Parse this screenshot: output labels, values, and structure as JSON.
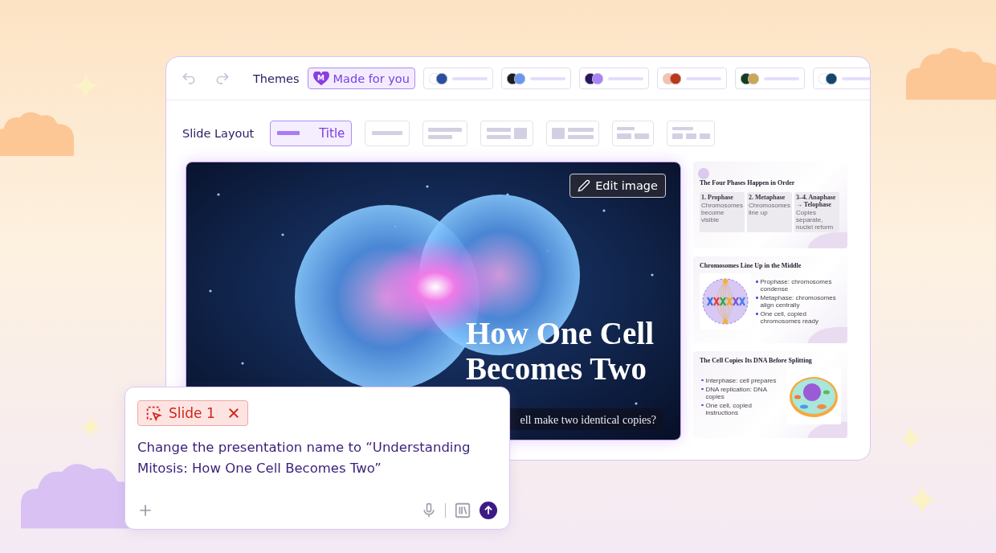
{
  "toolbar": {
    "themes_label": "Themes",
    "made_for_you": {
      "letter": "M",
      "label": "Made for you",
      "selected": true
    },
    "themes": [
      {
        "selected": false,
        "dots": [
          {
            "color": "#ffffff"
          },
          {
            "color": "#2a4f9c"
          }
        ]
      },
      {
        "selected": false,
        "dots": [
          {
            "color": "#1c1c1c"
          },
          {
            "color": "#6a96ee"
          }
        ]
      },
      {
        "selected": false,
        "dots": [
          {
            "color": "#2a165e"
          },
          {
            "color": "#a885f2"
          }
        ]
      },
      {
        "selected": false,
        "dots": [
          {
            "color": "#f4c2ae"
          },
          {
            "color": "#b83a1e"
          }
        ]
      },
      {
        "selected": false,
        "dots": [
          {
            "color": "#173a25"
          },
          {
            "color": "#c9a85a"
          }
        ]
      },
      {
        "selected": false,
        "dots": [
          {
            "color": "#ffffff"
          },
          {
            "color": "#14466e"
          }
        ]
      }
    ]
  },
  "slide_layout": {
    "label": "Slide Layout",
    "options": [
      {
        "kind": "title",
        "label": "Title",
        "selected": true
      },
      {
        "kind": "heading",
        "selected": false
      },
      {
        "kind": "text",
        "selected": false
      },
      {
        "kind": "text-image",
        "selected": false
      },
      {
        "kind": "image-text",
        "selected": false
      },
      {
        "kind": "columns-2",
        "selected": false
      },
      {
        "kind": "columns-3",
        "selected": false
      }
    ]
  },
  "slide": {
    "edit_image": "Edit image",
    "title": "How One Cell Becomes Two",
    "subtitle": "ell make two identical copies?"
  },
  "thumbnails": [
    {
      "kind": "phases",
      "title": "The Four Phases Happen in Order",
      "boxes": [
        {
          "heading": "1. Prophase",
          "text": "Chromosomes become visible"
        },
        {
          "heading": "2. Metaphase",
          "text": "Chromosomes line up"
        },
        {
          "heading": "3–4. Anaphase → Telophase",
          "text": "Copies separate, nuclei reform"
        }
      ]
    },
    {
      "kind": "spindle",
      "title": "Chromosomes Line Up in the Middle",
      "bullets": [
        "Prophase: chromosomes condense",
        "Metaphase: chromosomes align centrally",
        "One cell, copied chromosomes ready"
      ]
    },
    {
      "kind": "cell",
      "title": "The Cell Copies Its DNA Before Splitting",
      "bullets": [
        "Interphase: cell prepares",
        "DNA replication: DNA copies",
        "One cell, copied instructions"
      ]
    }
  ],
  "chat": {
    "chip": "Slide 1",
    "message": "Change the presentation name to “Understanding Mitosis: How One Cell Becomes Two”"
  }
}
